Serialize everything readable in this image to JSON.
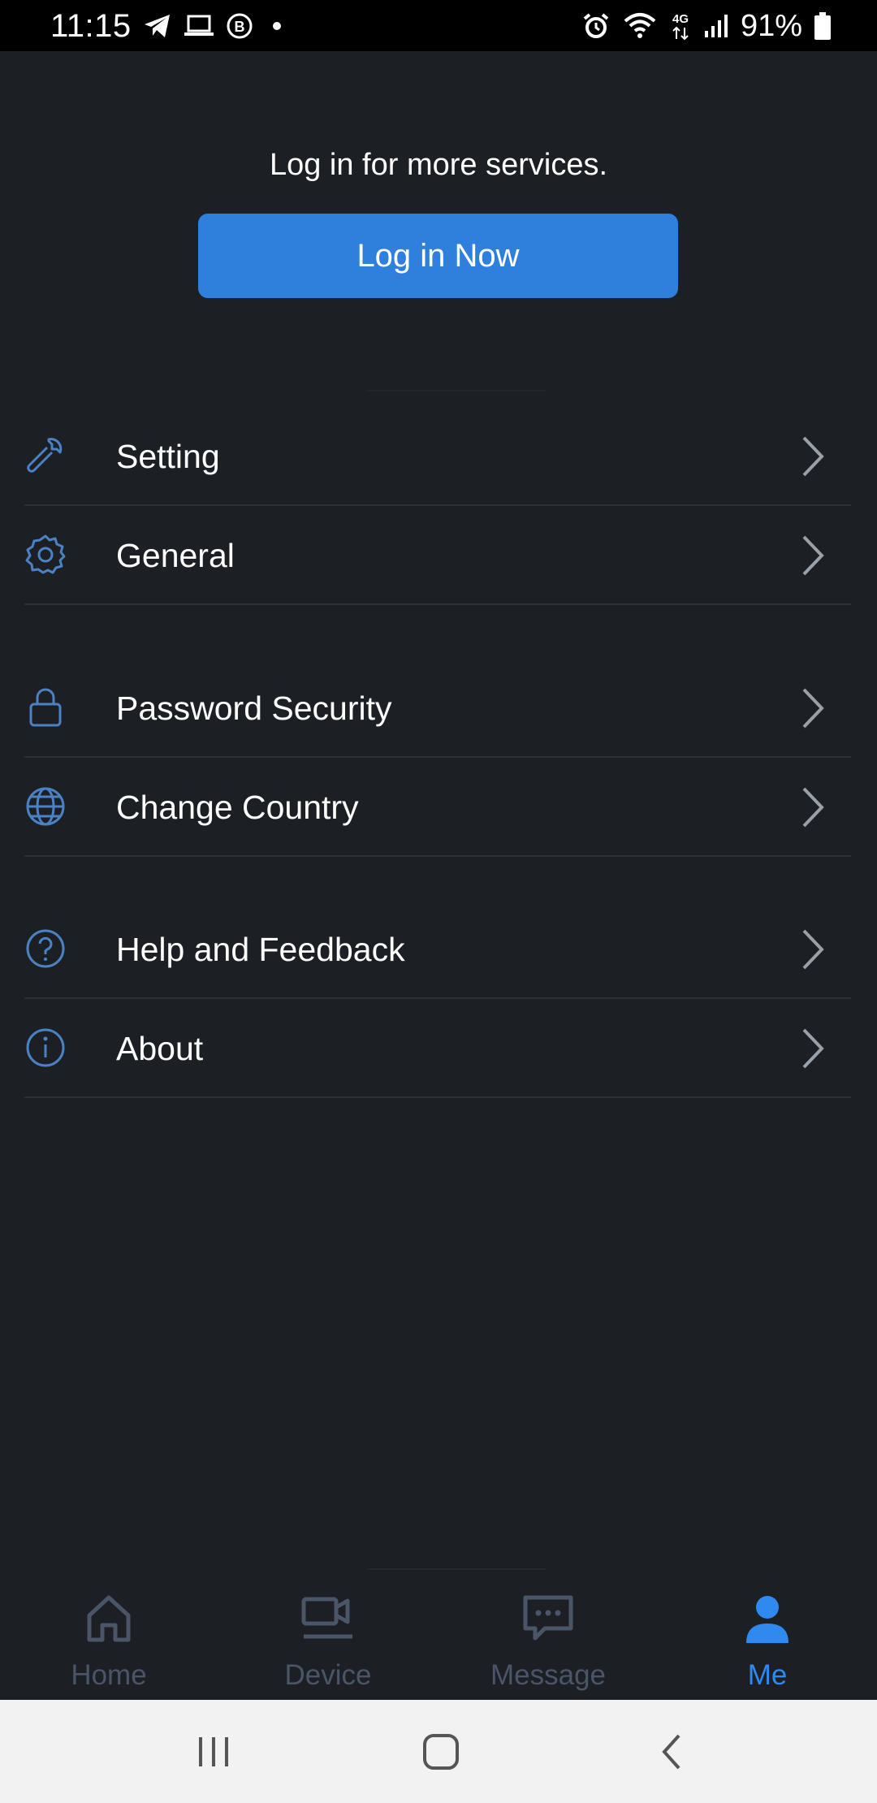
{
  "status_bar": {
    "time": "11:15",
    "battery": "91%",
    "icons": [
      "telegram-icon",
      "laptop-icon",
      "b-badge-icon",
      "dot-icon",
      "alarm-icon",
      "wifi-icon",
      "4g-icon",
      "signal-icon",
      "battery-icon"
    ]
  },
  "login": {
    "prompt": "Log in for more services.",
    "button_label": "Log in Now"
  },
  "menu": {
    "items": [
      {
        "label": "Setting",
        "icon": "wrench-icon"
      },
      {
        "label": "General",
        "icon": "gear-icon"
      },
      {
        "label": "Password Security",
        "icon": "lock-icon"
      },
      {
        "label": "Change Country",
        "icon": "globe-icon"
      },
      {
        "label": "Help and Feedback",
        "icon": "help-icon"
      },
      {
        "label": "About",
        "icon": "info-icon"
      }
    ]
  },
  "tabs": [
    {
      "label": "Home",
      "icon": "home-icon",
      "active": false
    },
    {
      "label": "Device",
      "icon": "camera-device-icon",
      "active": false
    },
    {
      "label": "Message",
      "icon": "message-icon",
      "active": false
    },
    {
      "label": "Me",
      "icon": "person-icon",
      "active": true
    }
  ],
  "colors": {
    "background": "#1c1f24",
    "accent": "#2f80dc",
    "active_tab": "#2f89ef",
    "inactive_tab": "#4a5568",
    "icon_blue": "#4a82c4"
  }
}
